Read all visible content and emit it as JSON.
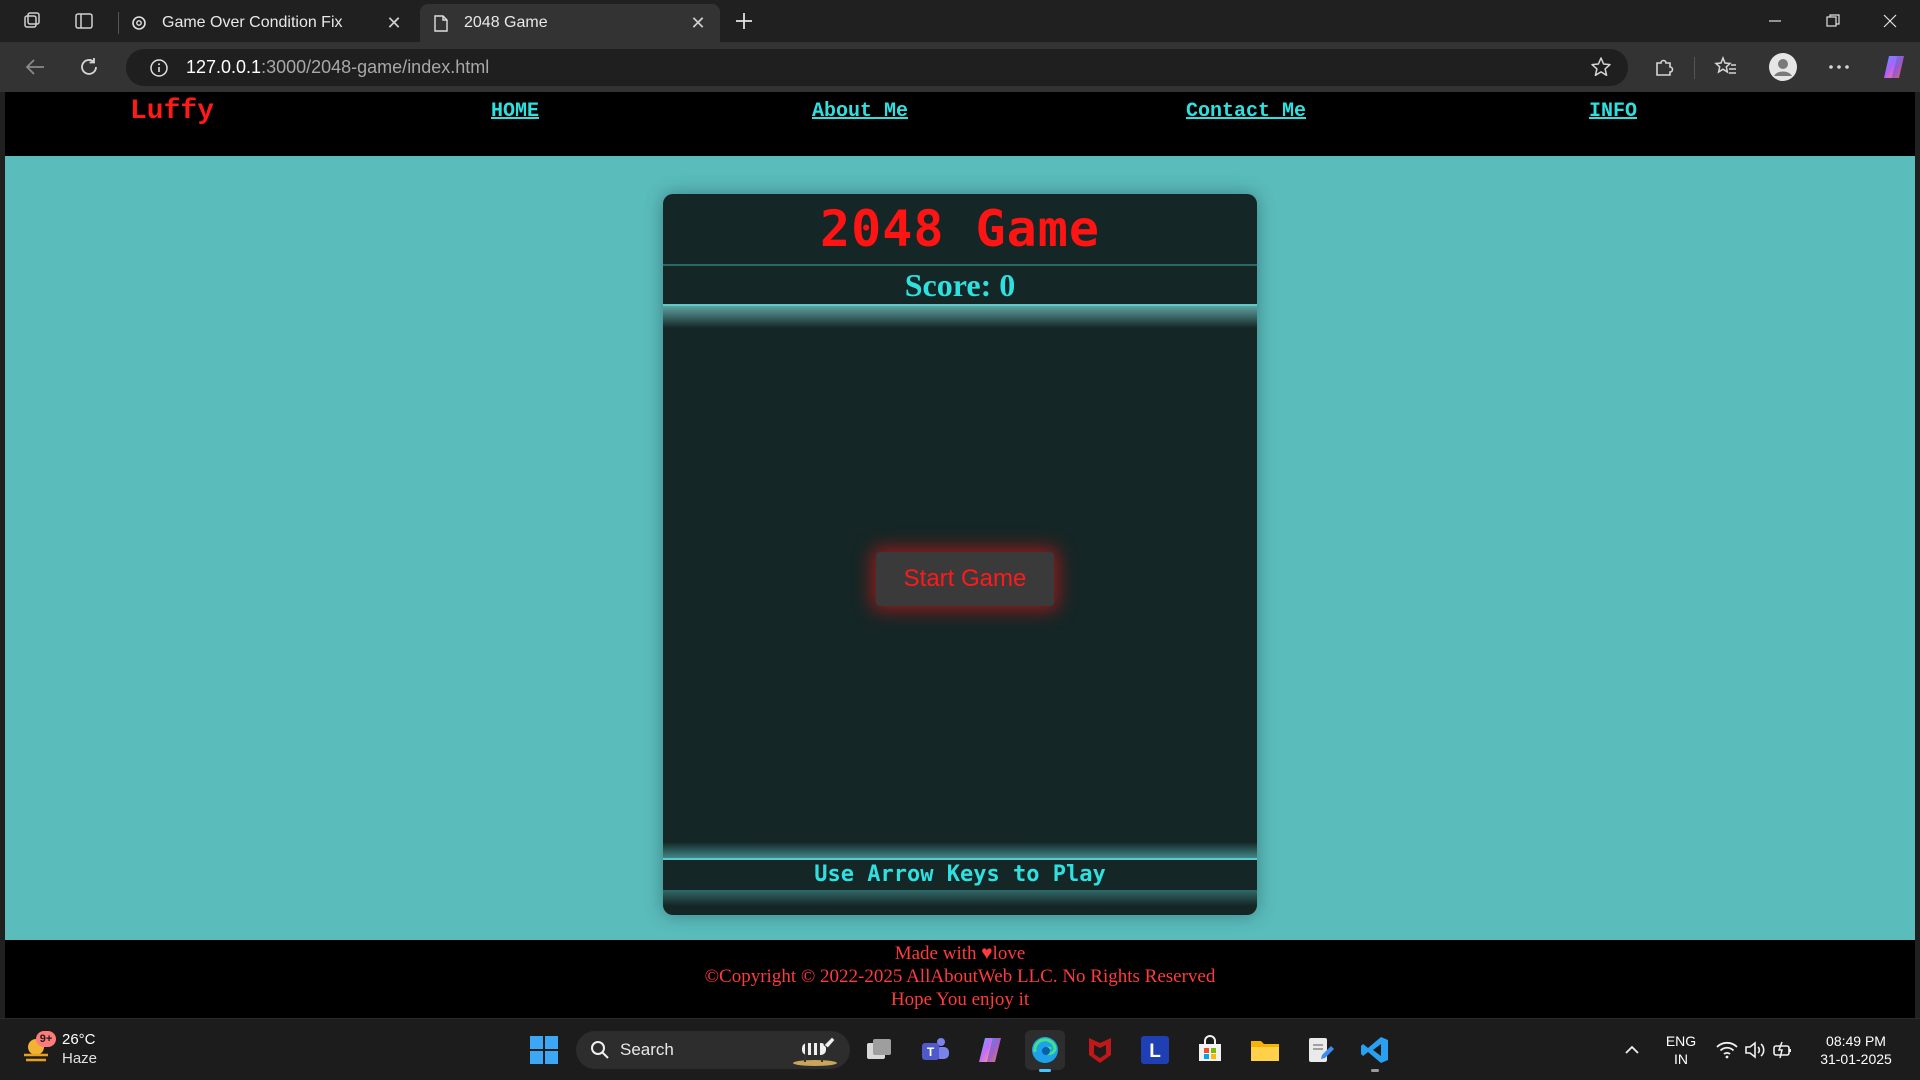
{
  "browser": {
    "tabs": [
      {
        "title": "Game Over Condition Fix",
        "active": false
      },
      {
        "title": "2048 Game",
        "active": true
      }
    ],
    "url_host": "127.0.0.1",
    "url_rest": ":3000/2048-game/index.html"
  },
  "site": {
    "logo": "Luffy",
    "nav": [
      "HOME",
      "About Me",
      "Contact Me",
      "INFO"
    ]
  },
  "game": {
    "title": "2048 Game",
    "score_label": "Score: 0",
    "start_label": "Start Game",
    "hint": "Use Arrow Keys to Play"
  },
  "footer": {
    "made_with": "Made with ♥love",
    "copyright": "©Copyright © 2022-2025 AllAboutWeb LLC. No Rights Reserved",
    "enjoy": "Hope You enjoy it"
  },
  "taskbar": {
    "weather_temp": "26°C",
    "weather_cond": "Haze",
    "weather_badge": "9+",
    "search_label": "Search",
    "lang_line1": "ENG",
    "lang_line2": "IN",
    "time": "08:49 PM",
    "date": "31-01-2025"
  },
  "colors": {
    "page_bg": "#5bbcbc",
    "accent_red": "#ff1414",
    "accent_cyan": "#2fe0e0",
    "card_bg": "#152626"
  }
}
